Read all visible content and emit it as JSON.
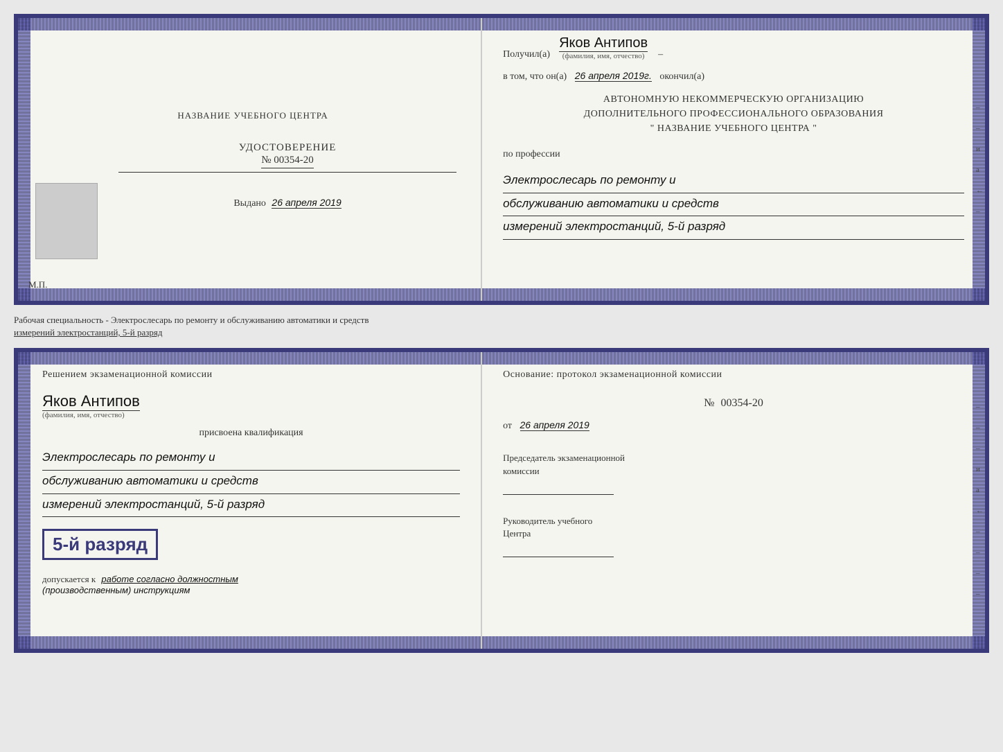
{
  "top_cert": {
    "left": {
      "school_name": "НАЗВАНИЕ УЧЕБНОГО ЦЕНТРА",
      "udostoverenie_title": "УДОСТОВЕРЕНИЕ",
      "udostoverenie_num": "№ 00354-20",
      "vydano_label": "Выдано",
      "vydano_date": "26 апреля 2019",
      "mp_label": "М.П."
    },
    "right": {
      "poluchil_label": "Получил(а)",
      "poluchil_name": "Яков Антипов",
      "fio_label": "(фамилия, имя, отчество)",
      "v_tom_prefix": "в том, что он(а)",
      "v_tom_date": "26 апреля 2019г.",
      "okonchil_label": "окончил(а)",
      "org_line1": "АВТОНОМНУЮ НЕКОММЕРЧЕСКУЮ ОРГАНИЗАЦИЮ",
      "org_line2": "ДОПОЛНИТЕЛЬНОГО ПРОФЕССИОНАЛЬНОГО ОБРАЗОВАНИЯ",
      "org_line3": "\" НАЗВАНИЕ УЧЕБНОГО ЦЕНТРА \"",
      "po_professii_label": "по профессии",
      "profession_line1": "Электрослесарь по ремонту и",
      "profession_line2": "обслуживанию автоматики и средств",
      "profession_line3": "измерений электростанций, 5-й разряд",
      "margin_i": "и",
      "margin_a": "а",
      "margin_left": "←"
    }
  },
  "separator": {
    "text_line1": "Рабочая специальность - Электрослесарь по ремонту и обслуживанию автоматики и средств",
    "text_line2": "измерений электростанций, 5-й разряд"
  },
  "bottom_cert": {
    "left": {
      "resheniem_text": "Решением  экзаменационной  комиссии",
      "name": "Яков Антипов",
      "fio_label": "(фамилия, имя, отчество)",
      "prisvoena_label": "присвоена квалификация",
      "prof_line1": "Электрослесарь по ремонту и",
      "prof_line2": "обслуживанию автоматики и средств",
      "prof_line3": "измерений электростанций, 5-й разряд",
      "rank_text": "5-й разряд",
      "dopuskaetsya_prefix": "допускается к",
      "dopuskaetsya_text": "работе согласно должностным",
      "dopuskaetsya_text2": "(производственным) инструкциям"
    },
    "right": {
      "osnovanie_text": "Основание: протокол экзаменационной  комиссии",
      "num_label": "№",
      "num_value": "00354-20",
      "ot_label": "от",
      "ot_date": "26 апреля 2019",
      "predsedatel_line1": "Председатель экзаменационной",
      "predsedatel_line2": "комиссии",
      "rukovoditel_line1": "Руководитель учебного",
      "rukovoditel_line2": "Центра",
      "margin_i": "и",
      "margin_a": "а",
      "margin_left": "←"
    }
  }
}
